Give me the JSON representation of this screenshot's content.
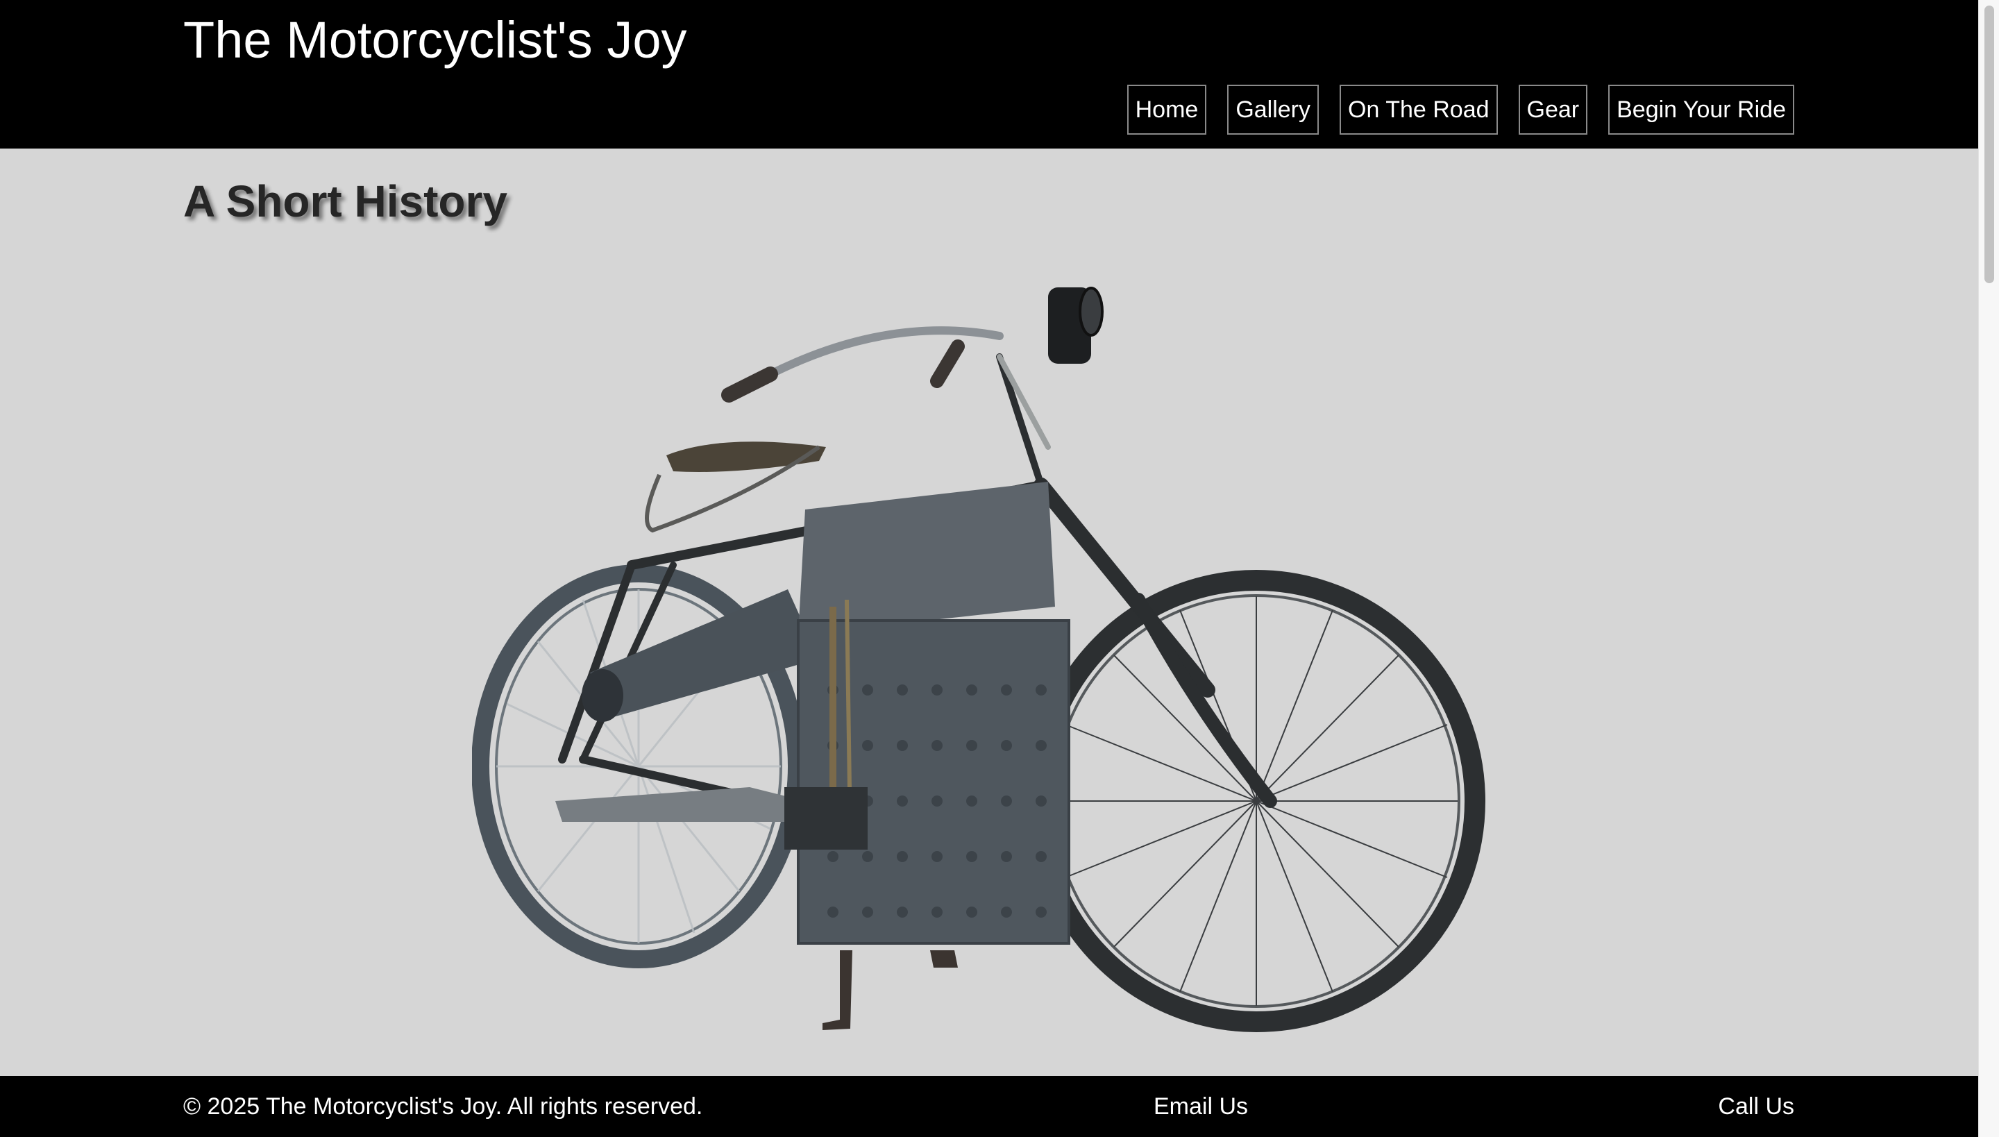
{
  "header": {
    "site_title": "The Motorcyclist's Joy",
    "nav": [
      {
        "label": "Home"
      },
      {
        "label": "Gallery"
      },
      {
        "label": "On The Road"
      },
      {
        "label": "Gear"
      },
      {
        "label": "Begin Your Ride"
      }
    ]
  },
  "main": {
    "heading": "A Short History",
    "image": {
      "alt": "Antique steam-powered motorcycle"
    }
  },
  "footer": {
    "copyright": "© 2025 The Motorcyclist's Joy. All rights reserved.",
    "email_label": "Email Us",
    "call_label": "Call Us"
  },
  "colors": {
    "header_bg": "#000000",
    "page_bg": "#d6d6d6",
    "footer_bg": "#000000",
    "text_light": "#ffffff",
    "heading_text": "#262626"
  }
}
